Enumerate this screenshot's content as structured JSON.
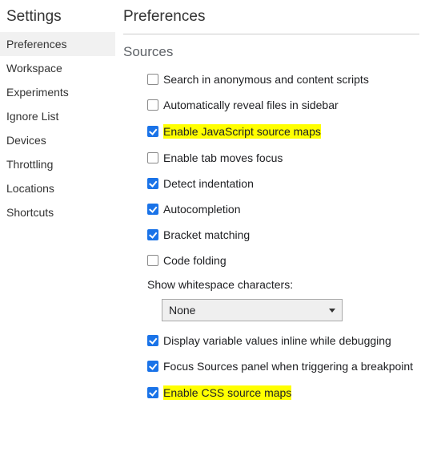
{
  "sidebar": {
    "title": "Settings",
    "items": [
      {
        "label": "Preferences",
        "active": true
      },
      {
        "label": "Workspace",
        "active": false
      },
      {
        "label": "Experiments",
        "active": false
      },
      {
        "label": "Ignore List",
        "active": false
      },
      {
        "label": "Devices",
        "active": false
      },
      {
        "label": "Throttling",
        "active": false
      },
      {
        "label": "Locations",
        "active": false
      },
      {
        "label": "Shortcuts",
        "active": false
      }
    ]
  },
  "main": {
    "title": "Preferences",
    "section_title": "Sources",
    "options": [
      {
        "label": "Search in anonymous and content scripts",
        "checked": false,
        "highlight": false
      },
      {
        "label": "Automatically reveal files in sidebar",
        "checked": false,
        "highlight": false
      },
      {
        "label": "Enable JavaScript source maps",
        "checked": true,
        "highlight": true
      },
      {
        "label": "Enable tab moves focus",
        "checked": false,
        "highlight": false
      },
      {
        "label": "Detect indentation",
        "checked": true,
        "highlight": false
      },
      {
        "label": "Autocompletion",
        "checked": true,
        "highlight": false
      },
      {
        "label": "Bracket matching",
        "checked": true,
        "highlight": false
      },
      {
        "label": "Code folding",
        "checked": false,
        "highlight": false
      }
    ],
    "whitespace": {
      "label": "Show whitespace characters:",
      "select_value": "None"
    },
    "options2": [
      {
        "label": "Display variable values inline while debugging",
        "checked": true,
        "highlight": false
      },
      {
        "label": "Focus Sources panel when triggering a breakpoint",
        "checked": true,
        "highlight": false
      },
      {
        "label": "Enable CSS source maps",
        "checked": true,
        "highlight": true
      }
    ]
  }
}
